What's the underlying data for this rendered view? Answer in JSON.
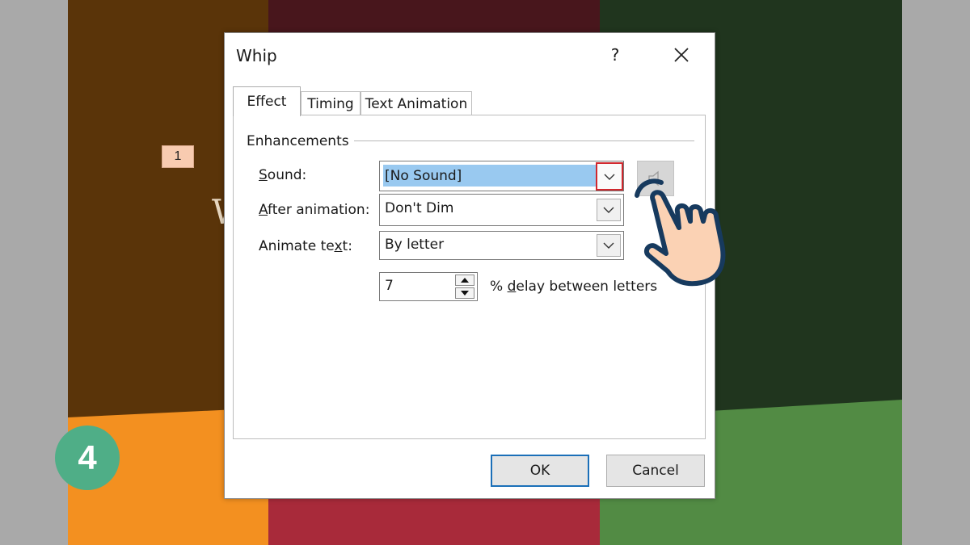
{
  "slide": {
    "animation_tag": "1",
    "step_badge": "4",
    "colors": {
      "brown": "#5a3409",
      "maroon": "#48161c",
      "dark_green": "#20351e",
      "orange": "#f39020",
      "red": "#a82a3a",
      "green": "#528b44",
      "badge": "#4fae87"
    }
  },
  "dialog": {
    "title": "Whip",
    "help_label": "?",
    "tabs": [
      {
        "label": "Effect",
        "active": true
      },
      {
        "label": "Timing",
        "active": false
      },
      {
        "label": "Text Animation",
        "active": false
      }
    ],
    "group_label": "Enhancements",
    "sound": {
      "label_accel": "S",
      "label_rest": "ound:",
      "value": "[No Sound]"
    },
    "after_animation": {
      "label_accel": "A",
      "label_rest": "fter animation:",
      "value": "Don't Dim"
    },
    "animate_text": {
      "label_pre": "Animate te",
      "label_accel": "x",
      "label_post": "t:",
      "value": "By letter"
    },
    "delay": {
      "value": "7",
      "suffix_pre": "% ",
      "suffix_accel": "d",
      "suffix_post": "elay between letters"
    },
    "ok_label": "OK",
    "cancel_label": "Cancel"
  },
  "icons": {
    "close": "close-icon",
    "dropdown": "chevron-down-icon",
    "speaker": "speaker-icon",
    "pointer": "hand-pointer-icon"
  }
}
